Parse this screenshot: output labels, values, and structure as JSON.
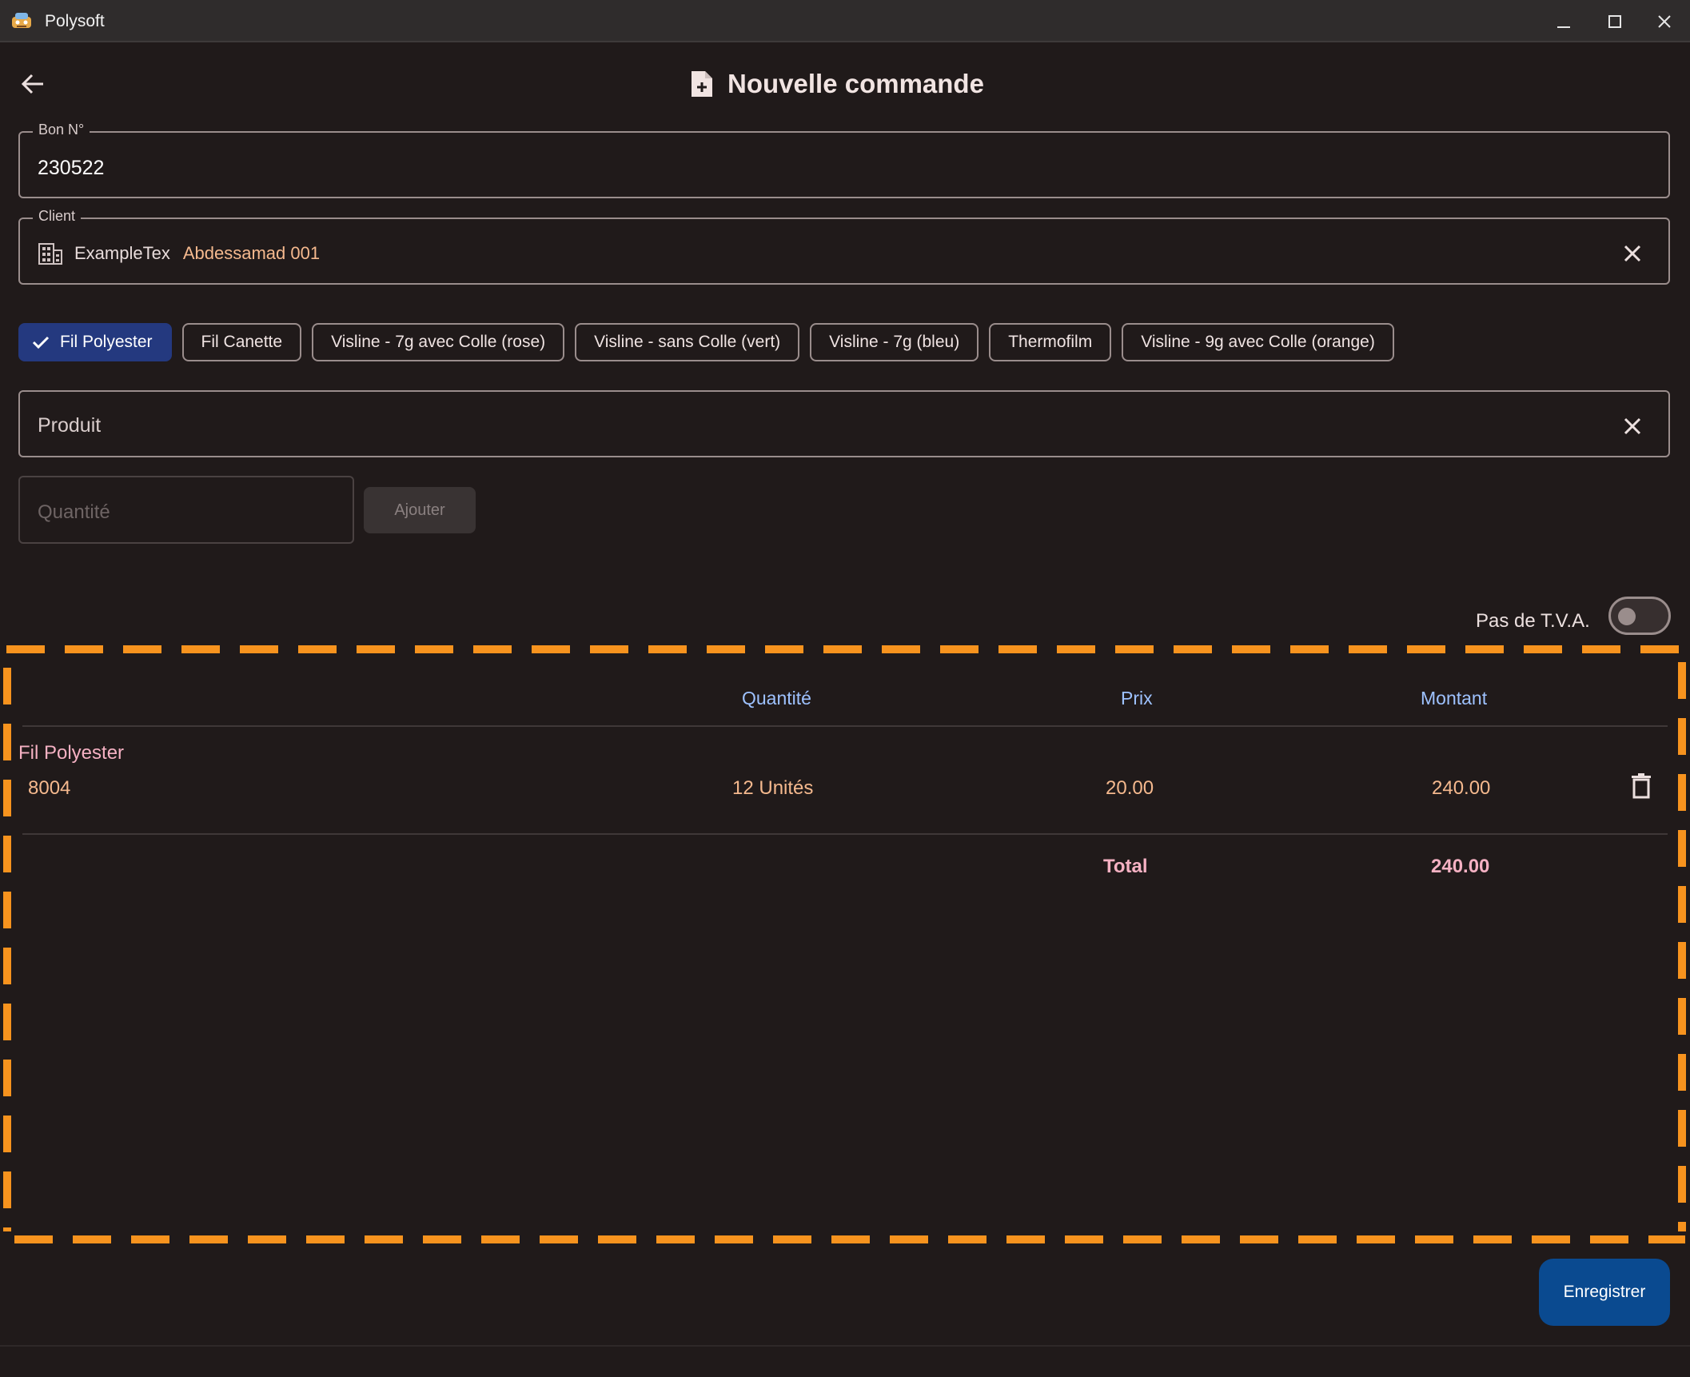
{
  "window": {
    "title": "Polysoft",
    "controls": [
      "minimize-icon",
      "maximize-icon",
      "close-icon"
    ]
  },
  "header": {
    "back_icon": "arrow-left-icon",
    "title_icon": "file-plus-icon",
    "title": "Nouvelle commande"
  },
  "form": {
    "bon": {
      "label": "Bon N°",
      "value": "230522"
    },
    "client": {
      "label": "Client",
      "icon": "building-icon",
      "name": "ExampleTex",
      "reference": "Abdessamad 001",
      "clear_icon": "close-icon"
    },
    "categories": [
      {
        "label": "Fil Polyester",
        "selected": true
      },
      {
        "label": "Fil Canette",
        "selected": false
      },
      {
        "label": "Visline - 7g avec Colle (rose)",
        "selected": false
      },
      {
        "label": "Visline - sans Colle (vert)",
        "selected": false
      },
      {
        "label": "Visline - 7g (bleu)",
        "selected": false
      },
      {
        "label": "Thermofilm",
        "selected": false
      },
      {
        "label": "Visline - 9g avec Colle (orange)",
        "selected": false
      }
    ],
    "produit": {
      "label": "Produit",
      "clear_icon": "close-icon"
    },
    "quantite": {
      "placeholder": "Quantité"
    },
    "ajouter_label": "Ajouter",
    "tva": {
      "label": "Pas de T.V.A.",
      "enabled": false
    }
  },
  "table": {
    "headers": {
      "quantite": "Quantité",
      "prix": "Prix",
      "montant": "Montant"
    },
    "groups": [
      {
        "title": "Fil Polyester",
        "rows": [
          {
            "ref": "8004",
            "quantite": "12 Unités",
            "prix": "20.00",
            "montant": "240.00",
            "delete_icon": "trash-icon"
          }
        ]
      }
    ],
    "total_label": "Total",
    "total_value": "240.00"
  },
  "actions": {
    "save_label": "Enregistrer"
  },
  "colors": {
    "background": "#201a1a",
    "accent_selected_chip": "#24397f",
    "header_text": "#9ec2ff",
    "value_text": "#f5b98e",
    "group_text": "#f5b1c3",
    "save_button": "#0a4a90",
    "highlight_dash": "#f7931e"
  }
}
